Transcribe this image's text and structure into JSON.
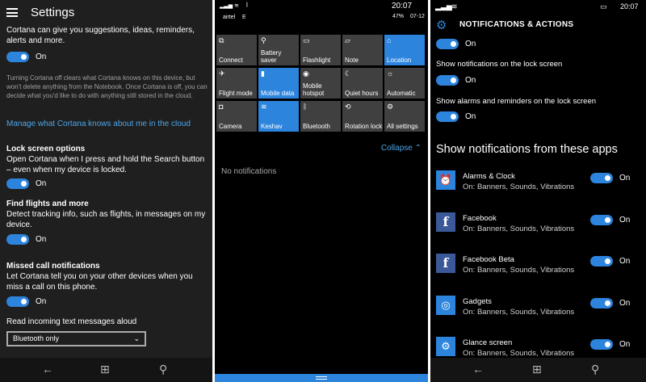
{
  "panel1": {
    "title": "Settings",
    "intro": "Cortana can give you suggestions, ideas, reminders, alerts and more.",
    "toggle_on_label": "On",
    "note": "Turning Cortana off clears what Cortana knows on this device, but won't delete anything from the Notebook. Once Cortana is off, you can decide what you'd like to do with anything still stored in the cloud.",
    "manage_link": "Manage what Cortana knows about me in the cloud",
    "sections": [
      {
        "title": "Lock screen options",
        "desc": "Open Cortana when I press and hold the Search button – even when my device is locked.",
        "state": "On"
      },
      {
        "title": "Find flights and more",
        "desc": "Detect tracking info, such as flights, in messages on my device.",
        "state": "On"
      },
      {
        "title": "Missed call notifications",
        "desc": "Let Cortana tell you on your other devices when you miss a call on this phone.",
        "state": "On"
      }
    ],
    "read_aloud_label": "Read incoming text messages aloud",
    "read_aloud_value": "Bluetooth only"
  },
  "panel2": {
    "carrier": "airtel",
    "carrier_net": "E",
    "time": "20:07",
    "battery": "47%",
    "date": "07-12",
    "tiles": [
      {
        "label": "Connect",
        "icon": "connect-icon",
        "glyph": "⧉",
        "on": false
      },
      {
        "label": "Battery saver",
        "icon": "battery-saver-icon",
        "glyph": "⚲",
        "on": false
      },
      {
        "label": "Flashlight",
        "icon": "flashlight-icon",
        "glyph": "▭",
        "on": false
      },
      {
        "label": "Note",
        "icon": "note-icon",
        "glyph": "▱",
        "on": false
      },
      {
        "label": "Location",
        "icon": "location-icon",
        "glyph": "⌂",
        "on": true
      },
      {
        "label": "Flight mode",
        "icon": "airplane-icon",
        "glyph": "✈",
        "on": false
      },
      {
        "label": "Mobile data",
        "icon": "mobile-data-icon",
        "glyph": "▮",
        "on": true
      },
      {
        "label": "Mobile hotspot",
        "icon": "hotspot-icon",
        "glyph": "◉",
        "on": false
      },
      {
        "label": "Quiet hours",
        "icon": "moon-icon",
        "glyph": "☾",
        "on": false
      },
      {
        "label": "Automatic",
        "icon": "brightness-icon",
        "glyph": "☼",
        "on": false
      },
      {
        "label": "Camera",
        "icon": "camera-icon",
        "glyph": "◘",
        "on": false
      },
      {
        "label": "Keshav",
        "icon": "wifi-icon",
        "glyph": "≋",
        "on": true
      },
      {
        "label": "Bluetooth",
        "icon": "bluetooth-icon",
        "glyph": "ᛒ",
        "on": false
      },
      {
        "label": "Rotation lock",
        "icon": "rotation-lock-icon",
        "glyph": "⟲",
        "on": false
      },
      {
        "label": "All settings",
        "icon": "gear-icon",
        "glyph": "⚙",
        "on": false
      }
    ],
    "collapse_label": "Collapse",
    "no_notifications": "No notifications"
  },
  "panel3": {
    "time": "20:07",
    "title": "NOTIFICATIONS & ACTIONS",
    "top_state": "On",
    "lock_screen_label": "Show notifications on the lock screen",
    "lock_screen_state": "On",
    "alarms_label": "Show alarms and reminders on the lock screen",
    "alarms_state": "On",
    "apps_heading": "Show notifications from these apps",
    "apps": [
      {
        "name": "Alarms & Clock",
        "sub": "On: Banners, Sounds, Vibrations",
        "state": "On",
        "icon": "alarm-clock-icon",
        "glyph": "⏰",
        "fb": false
      },
      {
        "name": "Facebook",
        "sub": "On: Banners, Sounds, Vibrations",
        "state": "On",
        "icon": "facebook-icon",
        "glyph": "f",
        "fb": true
      },
      {
        "name": "Facebook Beta",
        "sub": "On: Banners, Sounds, Vibrations",
        "state": "On",
        "icon": "facebook-beta-icon",
        "glyph": "f",
        "fb": true
      },
      {
        "name": "Gadgets",
        "sub": "On: Banners, Sounds, Vibrations",
        "state": "On",
        "icon": "gadgets-icon",
        "glyph": "◎",
        "fb": false
      },
      {
        "name": "Glance screen",
        "sub": "On: Banners, Sounds, Vibrations",
        "state": "On",
        "icon": "glance-screen-icon",
        "glyph": "⚙",
        "fb": false
      }
    ]
  },
  "colors": {
    "accent": "#2c84dd",
    "link": "#4ea6ea",
    "panel_bg": "#1f1f1f",
    "tile_off": "#404040"
  }
}
